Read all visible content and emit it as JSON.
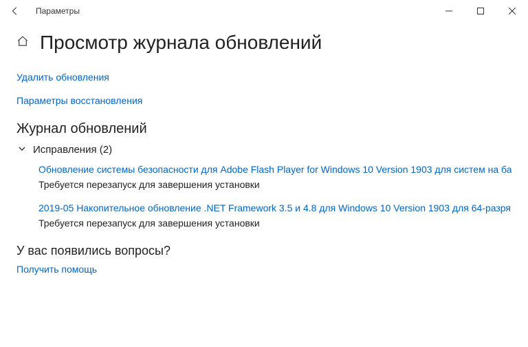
{
  "titlebar": {
    "title": "Параметры"
  },
  "page": {
    "heading": "Просмотр журнала обновлений"
  },
  "links": {
    "delete_updates": "Удалить обновления",
    "recovery_options": "Параметры восстановления"
  },
  "history": {
    "title": "Журнал обновлений",
    "group_label": "Исправления (2)",
    "items": [
      {
        "title": "Обновление системы безопасности для Adobe Flash Player for Windows 10 Version 1903 для систем на ба",
        "status": "Требуется перезапуск для завершения установки"
      },
      {
        "title": "2019-05 Накопительное обновление .NET Framework 3.5 и 4.8 для Windows 10 Version 1903 для 64-разря",
        "status": "Требуется перезапуск для завершения установки"
      }
    ]
  },
  "help": {
    "title": "У вас появились вопросы?",
    "link": "Получить помощь"
  }
}
